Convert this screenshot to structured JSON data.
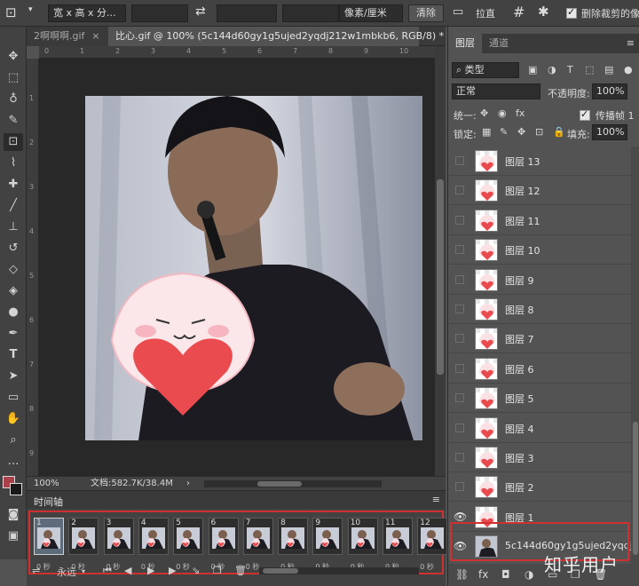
{
  "options_bar": {
    "tool_icon": "crop-icon",
    "ratio_label": "宽 x 高 x 分...",
    "unit_label": "像素/厘米",
    "clear_label": "清除",
    "straighten_label": "拉直",
    "delete_cropped_label": "删除裁剪的像"
  },
  "tabs": [
    {
      "label": "2啊啊啊.gif",
      "active": false
    },
    {
      "label": "比心.gif @ 100% (5c144d60gy1g5ujed2yqdj212w1mbkb6, RGB/8) *",
      "active": true
    }
  ],
  "ruler_top_labels": [
    "0",
    "1",
    "2",
    "3",
    "4",
    "5",
    "6",
    "7",
    "8",
    "9",
    "10"
  ],
  "ruler_left_labels": [
    "1",
    "2",
    "3",
    "4",
    "5",
    "6",
    "7",
    "8",
    "9"
  ],
  "status": {
    "zoom": "100%",
    "doc_label": "文档:582.7K/38.4M"
  },
  "timeline": {
    "title": "时间轴",
    "frames": [
      "1",
      "2",
      "3",
      "4",
      "5",
      "6",
      "7",
      "8",
      "9",
      "10",
      "11",
      "12"
    ],
    "frame_delay": "0 秒",
    "loop_label": "永远"
  },
  "layers_panel": {
    "tabs": [
      {
        "label": "图层",
        "active": true
      },
      {
        "label": "通道",
        "active": false
      }
    ],
    "filter_label": "类型",
    "blend_mode": "正常",
    "opacity_label": "不透明度:",
    "opacity_value": "100%",
    "unify_label": "统一:",
    "propagate_label": "传播帧 1",
    "lock_label": "锁定:",
    "fill_label": "填充:",
    "fill_value": "100%",
    "layers": [
      {
        "name": "图层 13",
        "visible": false
      },
      {
        "name": "图层 12",
        "visible": false
      },
      {
        "name": "图层 11",
        "visible": false
      },
      {
        "name": "图层 10",
        "visible": false
      },
      {
        "name": "图层 9",
        "visible": false
      },
      {
        "name": "图层 8",
        "visible": false
      },
      {
        "name": "图层 7",
        "visible": false
      },
      {
        "name": "图层 6",
        "visible": false
      },
      {
        "name": "图层 5",
        "visible": false
      },
      {
        "name": "图层 4",
        "visible": false
      },
      {
        "name": "图层 3",
        "visible": false
      },
      {
        "name": "图层 2",
        "visible": false
      },
      {
        "name": "图层 1",
        "visible": true
      },
      {
        "name": "5c144d60gy1g5ujed2yqdj21...",
        "visible": true
      }
    ]
  },
  "watermark": "知乎用户"
}
